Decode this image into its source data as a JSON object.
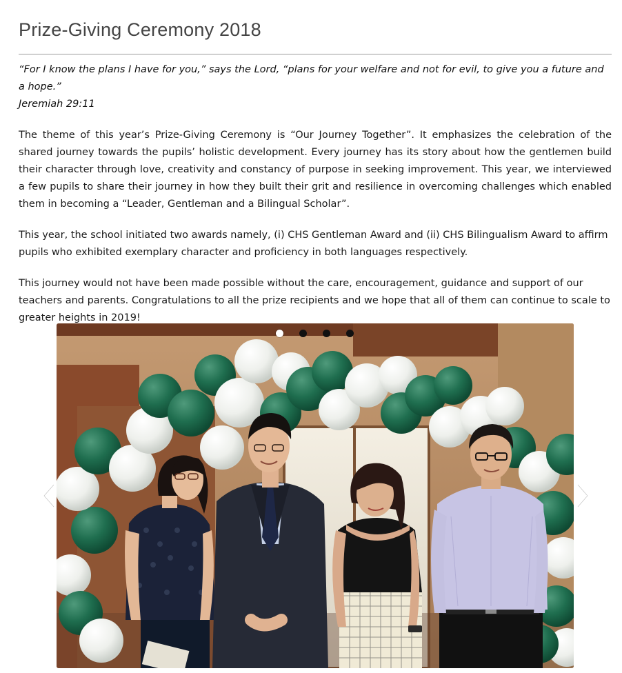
{
  "article": {
    "title": "Prize-Giving Ceremony 2018",
    "quote": {
      "text": "“For I know the plans I have for you,” says the Lord, “plans for your welfare and not for evil, to give you a future and a hope.”",
      "citation": "Jeremiah 29:11"
    },
    "paragraphs": [
      "The theme of this year’s Prize-Giving Ceremony is “Our Journey Together”. It emphasizes the celebration of the shared journey towards the pupils’ holistic development. Every journey has its story about how the gentlemen build their character through love, creativity and constancy of purpose in seeking improvement. This year, we interviewed a few pupils to share their journey in how they built their grit and resilience in overcoming challenges which enabled them in becoming a “Leader, Gentleman and a Bilingual Scholar”.",
      "This year, the school initiated two awards namely, (i) CHS Gentleman Award and (ii) CHS Bilingualism Award to affirm pupils who exhibited exemplary character and proficiency in both languages respectively.",
      "This journey would not have been made possible without the care, encouragement, guidance and support of our teachers and parents. Congratulations to all the prize recipients and we hope that all of them can continue to scale to greater heights in 2019!"
    ]
  },
  "slideshow": {
    "slide_count": 4,
    "active_index": 0,
    "colors": {
      "balloon_green": "#1f6e4f",
      "balloon_white": "#eef0ec",
      "wood": "#8a4a2c",
      "dot_inactive": "#111111",
      "dot_active": "#ffffff"
    },
    "icons": {
      "prev": "chevron-left-icon",
      "next": "chevron-right-icon"
    }
  }
}
